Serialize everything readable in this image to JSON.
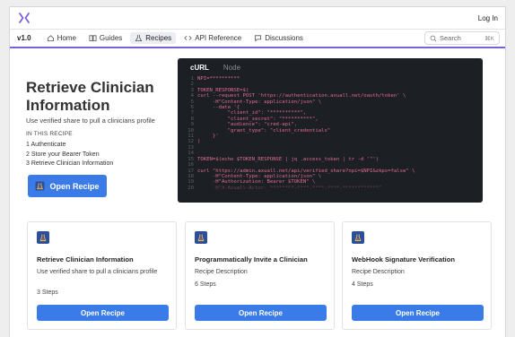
{
  "topbar": {
    "login_label": "Log In"
  },
  "nav": {
    "version": "v1.0",
    "items": [
      {
        "label": "Home",
        "icon": "home-icon"
      },
      {
        "label": "Guides",
        "icon": "book-icon"
      },
      {
        "label": "Recipes",
        "icon": "flask-icon",
        "active": true
      },
      {
        "label": "API Reference",
        "icon": "code-icon"
      },
      {
        "label": "Discussions",
        "icon": "chat-icon"
      }
    ],
    "search_placeholder": "Search",
    "search_shortcut": "⌘K"
  },
  "hero": {
    "title": "Retrieve Clinician Information",
    "description": "Use verified share to pull a clinicians profile",
    "recipe_heading": "IN THIS RECIPE",
    "steps": [
      "1  Authenticate",
      "2  Store your Bearer Token",
      "3  Retrieve Clinician Information"
    ],
    "button_label": "Open Recipe"
  },
  "code": {
    "tabs": [
      "cURL",
      "Node"
    ],
    "lines": [
      "NPI=**********",
      "",
      "TOKEN_RESPONSE=$(",
      "curl --request POST 'https://authentication.axuall.net/oauth/token' \\",
      "     -H\"Content-Type: application/json\" \\",
      "     --data '{",
      "          \"client_id\": \"**********\",",
      "          \"client_secret\": \"**********\",",
      "          \"audience\": \"cred-api\",",
      "          \"grant_type\": \"client_credentials\"",
      "     }'",
      ")",
      "",
      "",
      "TOKEN=$(echo $TOKEN_RESPONSE | jq .access_token | tr -d '\"')",
      "",
      "curl \"https://admin.axuall.net/api/verified_share?npi=$NPI&zkps=false\" \\",
      "     -H\"Content-Type: application/json\" \\",
      "     -H\"Authorization: Bearer $TOKEN\" \\",
      "     -H\"X-Axuall-Actor: ********-****-****-****-************\""
    ]
  },
  "cards": [
    {
      "title": "Retrieve Clinician Information",
      "description": "Use verified share to pull a clinicians profile",
      "steps": "3 Steps",
      "button_label": "Open Recipe"
    },
    {
      "title": "Programmatically Invite a Clinician",
      "description": "Recipe Description",
      "steps": "6 Steps",
      "button_label": "Open Recipe"
    },
    {
      "title": "WebHook Signature Verification",
      "description": "Recipe Description",
      "steps": "4 Steps",
      "button_label": "Open Recipe"
    }
  ],
  "colors": {
    "accent": "#7b5fd6",
    "button": "#3a7be7",
    "code_bg": "#1c1f24",
    "code_text": "#e06c8f"
  }
}
